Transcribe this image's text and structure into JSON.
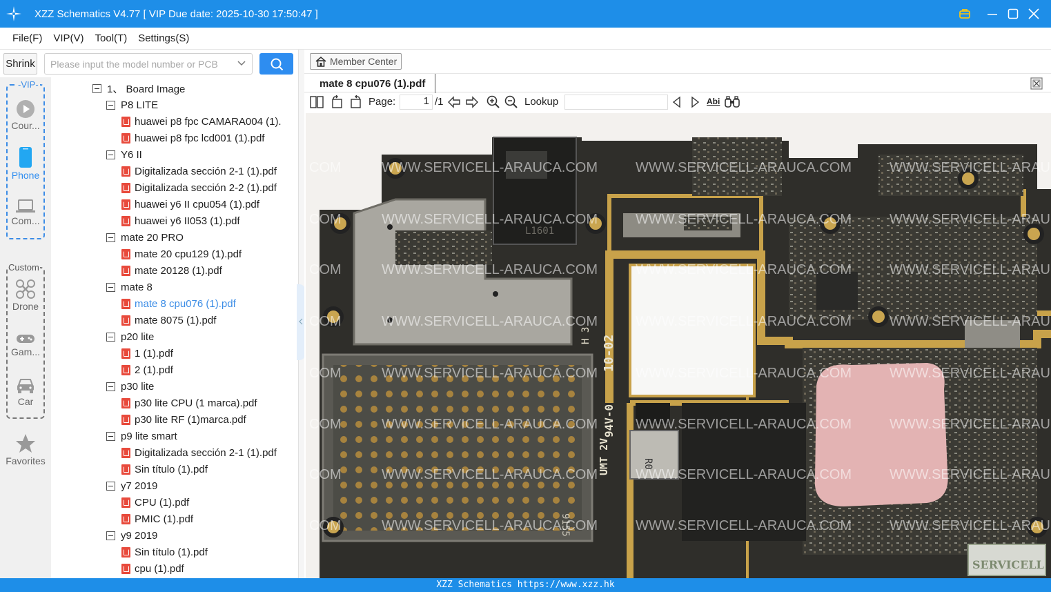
{
  "app": {
    "title": "XZZ Schematics V4.77 [ VIP Due date: 2025-10-30 17:50:47 ]"
  },
  "menu": [
    "File(F)",
    "VIP(V)",
    "Tool(T)",
    "Settings(S)"
  ],
  "toolbar": {
    "shrink_label": "Shrink",
    "search_placeholder": "Please input the model number or PCB"
  },
  "sidebar": {
    "vip_label": "VIP",
    "custom_label": "Custom",
    "items": [
      {
        "label": "Cour...",
        "icon": "play-circle-icon"
      },
      {
        "label": "Phone",
        "icon": "phone-icon",
        "active": true
      },
      {
        "label": "Com...",
        "icon": "laptop-icon"
      },
      {
        "label": "Drone",
        "icon": "drone-icon"
      },
      {
        "label": "Gam...",
        "icon": "gamepad-icon"
      },
      {
        "label": "Car",
        "icon": "car-icon"
      },
      {
        "label": "Favorites",
        "icon": "star-icon"
      }
    ]
  },
  "tree": [
    {
      "level": 0,
      "type": "folder",
      "label": "1、 Board Image"
    },
    {
      "level": 1,
      "type": "folder",
      "label": "P8 LITE"
    },
    {
      "level": 2,
      "type": "file",
      "label": "huawei p8 fpc CAMARA004 (1)."
    },
    {
      "level": 2,
      "type": "file",
      "label": "huawei p8 fpc lcd001 (1).pdf"
    },
    {
      "level": 1,
      "type": "folder",
      "label": "Y6 II"
    },
    {
      "level": 2,
      "type": "file",
      "label": "Digitalizada sección 2-1 (1).pdf"
    },
    {
      "level": 2,
      "type": "file",
      "label": "Digitalizada sección 2-2 (1).pdf"
    },
    {
      "level": 2,
      "type": "file",
      "label": "huawei y6 II cpu054 (1).pdf"
    },
    {
      "level": 2,
      "type": "file",
      "label": "huawei y6 II053 (1).pdf"
    },
    {
      "level": 1,
      "type": "folder",
      "label": "mate 20 PRO"
    },
    {
      "level": 2,
      "type": "file",
      "label": "mate 20 cpu129 (1).pdf"
    },
    {
      "level": 2,
      "type": "file",
      "label": "mate 20128 (1).pdf"
    },
    {
      "level": 1,
      "type": "folder",
      "label": "mate 8"
    },
    {
      "level": 2,
      "type": "file",
      "label": "mate 8 cpu076 (1).pdf",
      "selected": true
    },
    {
      "level": 2,
      "type": "file",
      "label": "mate 8075 (1).pdf"
    },
    {
      "level": 1,
      "type": "folder",
      "label": "p20 lite"
    },
    {
      "level": 2,
      "type": "file",
      "label": "1 (1).pdf"
    },
    {
      "level": 2,
      "type": "file",
      "label": "2 (1).pdf"
    },
    {
      "level": 1,
      "type": "folder",
      "label": "p30 lite"
    },
    {
      "level": 2,
      "type": "file",
      "label": "p30 lite CPU (1 marca).pdf"
    },
    {
      "level": 2,
      "type": "file",
      "label": "p30 lite RF (1)marca.pdf"
    },
    {
      "level": 1,
      "type": "folder",
      "label": "p9 lite smart"
    },
    {
      "level": 2,
      "type": "file",
      "label": "Digitalizada sección 2-1 (1).pdf"
    },
    {
      "level": 2,
      "type": "file",
      "label": "Sin título (1).pdf"
    },
    {
      "level": 1,
      "type": "folder",
      "label": "y7 2019"
    },
    {
      "level": 2,
      "type": "file",
      "label": "CPU (1).pdf"
    },
    {
      "level": 2,
      "type": "file",
      "label": "PMIC (1).pdf"
    },
    {
      "level": 1,
      "type": "folder",
      "label": "y9 2019"
    },
    {
      "level": 2,
      "type": "file",
      "label": "Sin título (1).pdf"
    },
    {
      "level": 2,
      "type": "file",
      "label": "cpu (1).pdf"
    }
  ],
  "viewer": {
    "member_center_label": "Member Center",
    "doc_tab": "mate 8 cpu076 (1).pdf",
    "page_label": "Page:",
    "page_current": "1",
    "page_total": "/1",
    "lookup_label": "Lookup",
    "lookup_value": "",
    "abi_label": "Abi",
    "watermark_text": "WWW.SERVICELL-ARAUCA.COM",
    "watermark_prefix": "COM",
    "board_silk_1": "10-02",
    "board_silk_2": "94V-0",
    "board_silk_3": "UMT 2V",
    "board_silk_4": "H 3",
    "board_silk_5": "9155",
    "board_silk_6": "L1601",
    "board_silk_7": "R0",
    "stamp_text": "SERVICELL"
  },
  "status": {
    "text": "XZZ Schematics https://www.xzz.hk"
  },
  "colors": {
    "accent": "#1e8ee8",
    "selected_text": "#3c8de6",
    "pdf_icon": "#e84a3c"
  }
}
